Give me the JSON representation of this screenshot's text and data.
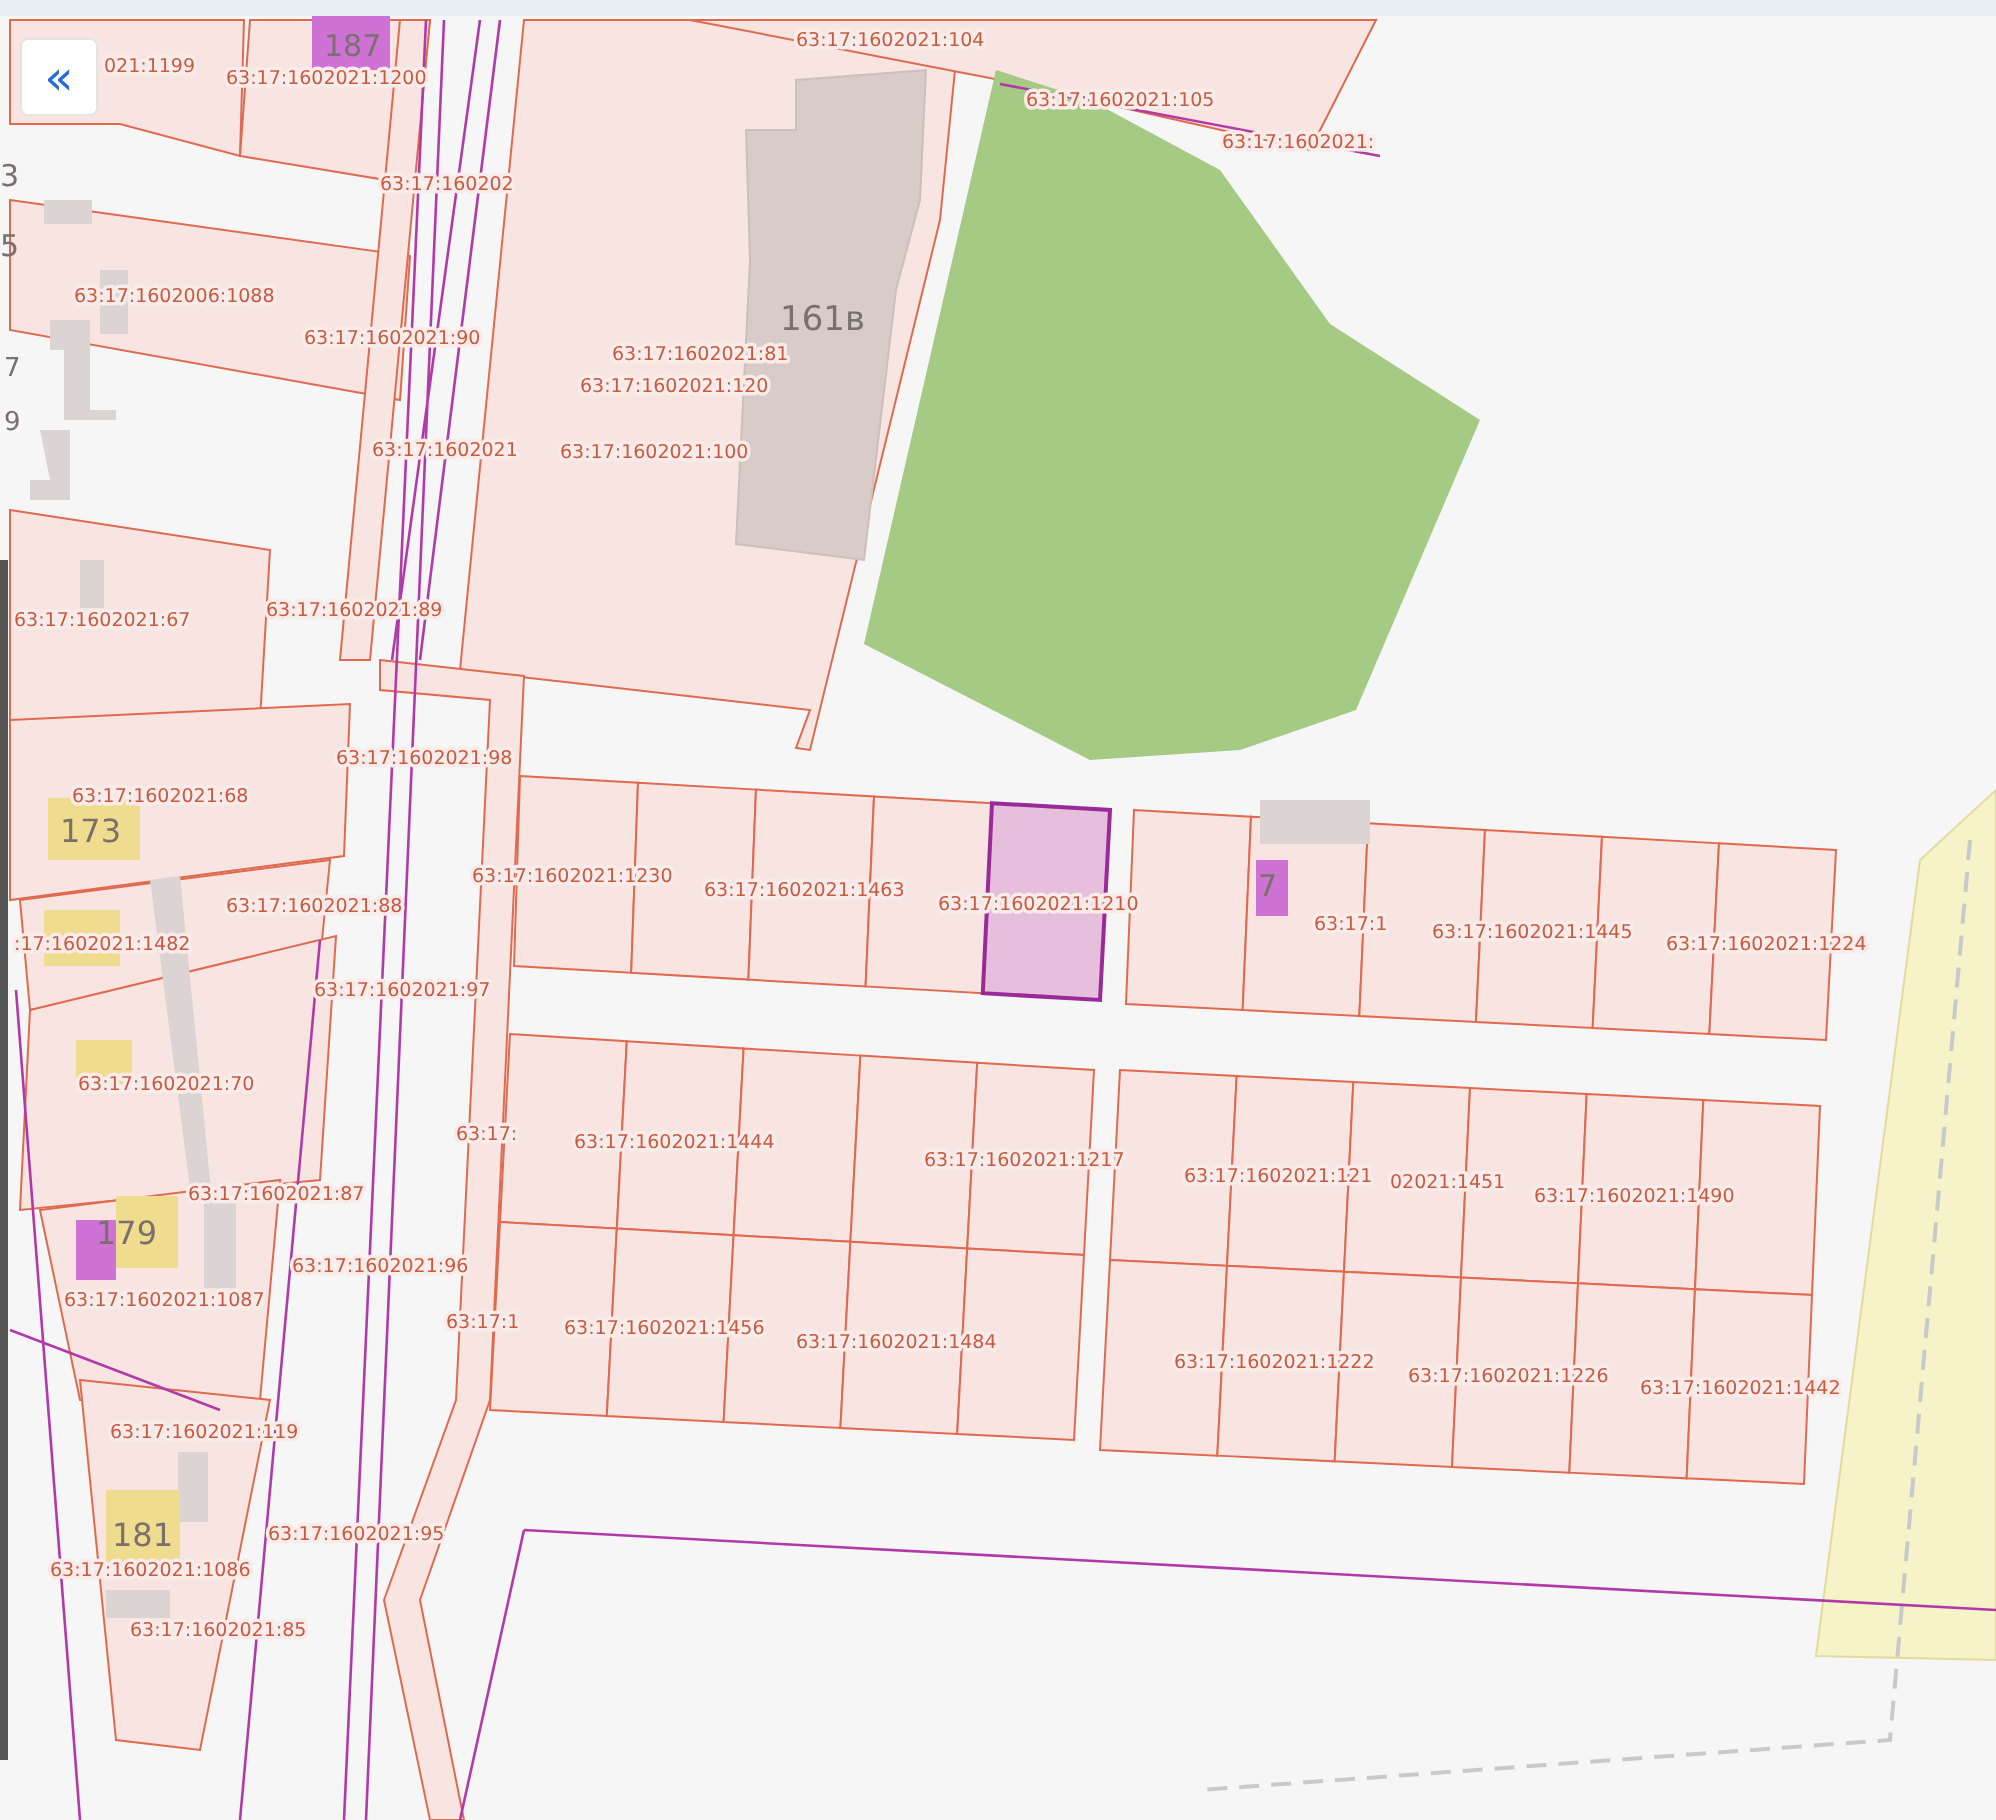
{
  "panel_toggle": {
    "label": "«"
  },
  "map": {
    "parcel_labels": [
      "021:1199",
      "63:17:1602021:1200",
      "63:17:1602021:104",
      "63:17:1602021:105",
      "63:17:1602021:",
      "63:17:160202",
      "63:17:1602006:1088",
      "63:17:1602021:90",
      "63:17:1602021:81",
      "63:17:1602021:120",
      "63:17:1602021",
      "63:17:1602021:100",
      "63:17:1602021:89",
      "63:17:1602021:67",
      "63:17:1602021:98",
      "63:17:1602021:68",
      "63:17:1602021:1230",
      "63:17:1602021:1463",
      "63:17:1602021:88",
      "63:17:1602021:1210",
      ":17:1602021:1482",
      "63:17:1",
      "63:17:1602021:1445",
      "63:17:1602021:1224",
      "63:17:1602021:97",
      "63:17:1602021:70",
      "63:17:",
      "63:17:1602021:1444",
      "63:17:1602021:1217",
      "63:17:1602021:121",
      "02021:1451",
      "63:17:1602021:87",
      "63:17:1602021:1490",
      "63:17:1602021:96",
      "63:17:1602021:1087",
      "63:17:1",
      "63:17:1602021:1456",
      "63:17:1602021:1484",
      "63:17:1602021:1222",
      "63:17:1602021:1226",
      "63:17:1602021:1442",
      "63:17:1602021:119",
      "63:17:1602021:95",
      "63:17:1602021:1086",
      "63:17:1602021:85"
    ],
    "house_numbers": [
      "187",
      "3",
      "5",
      "7",
      "9",
      "161в",
      "173",
      "7",
      "179",
      "181"
    ],
    "highlighted_parcel": {
      "selected": true
    }
  }
}
